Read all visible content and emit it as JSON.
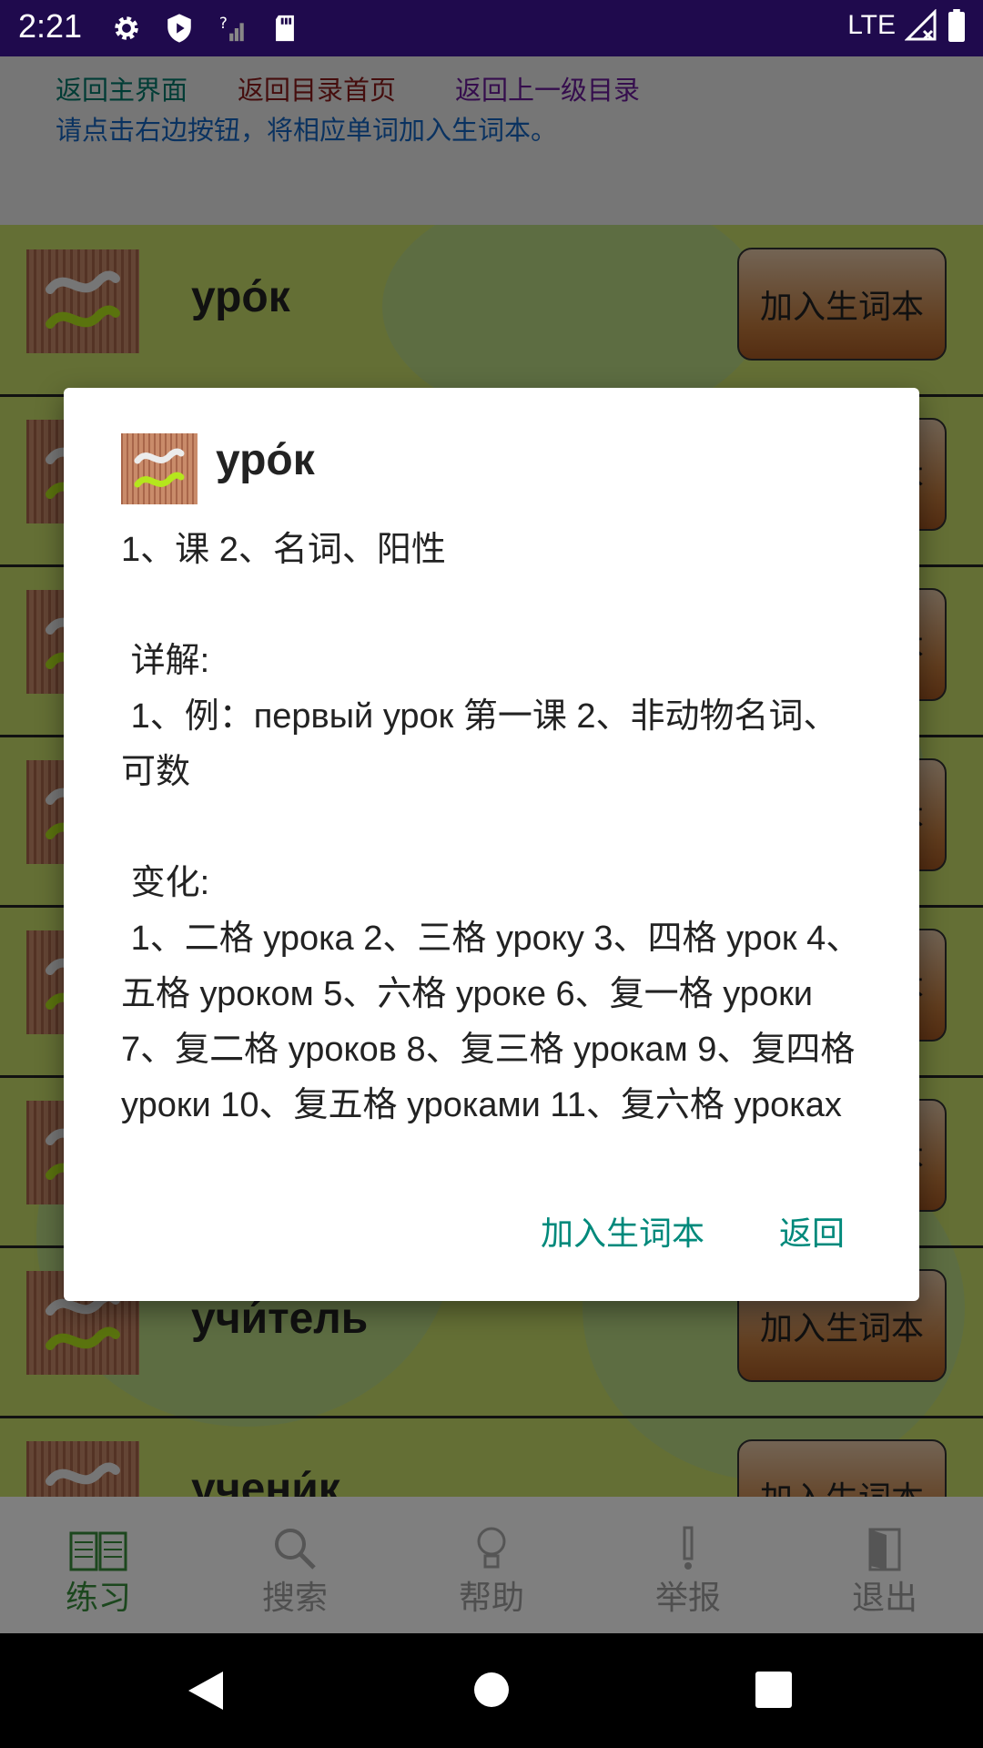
{
  "status_bar": {
    "time": "2:21",
    "network": "LTE",
    "icons": [
      "gear-icon",
      "shield-play-icon",
      "no-signal-icon",
      "sd-card-icon",
      "signal-icon",
      "battery-icon"
    ]
  },
  "top_nav": {
    "links": [
      {
        "label": "返回主界面",
        "color": "#00796b"
      },
      {
        "label": "返回目录首页",
        "color": "#8b1a1a"
      },
      {
        "label": "返回上一级目录",
        "color": "#6a1b9a"
      }
    ],
    "hint": "请点击右边按钮，将相应单词加入生词本。"
  },
  "word_list": {
    "add_label": "加入生词本",
    "rows": [
      {
        "word": "уро́к"
      },
      {
        "word": ""
      },
      {
        "word": ""
      },
      {
        "word": ""
      },
      {
        "word": ""
      },
      {
        "word": ""
      },
      {
        "word": "учи́тель"
      },
      {
        "word": "учени́к"
      }
    ]
  },
  "bottom_nav": {
    "tabs": [
      {
        "label": "练习",
        "icon": "book-icon",
        "active": true
      },
      {
        "label": "搜索",
        "icon": "search-icon",
        "active": false
      },
      {
        "label": "帮助",
        "icon": "lightbulb-icon",
        "active": false
      },
      {
        "label": "举报",
        "icon": "exclamation-icon",
        "active": false
      },
      {
        "label": "退出",
        "icon": "door-icon",
        "active": false
      }
    ]
  },
  "dialog": {
    "title": "уро́к",
    "body": "1、课 2、名词、阳性\n\n 详解:\n 1、例：первый урок 第一课 2、非动物名词、可数\n\n 变化:\n 1、二格 урока 2、三格 уроку 3、四格 урок 4、五格 уроком 5、六格 уроке 6、复一格 уроки 7、复二格 уроков 8、复三格 урокам 9、复四格 уроки 10、复五格 уроками 11、复六格 уроках",
    "add_button": "加入生词本",
    "back_button": "返回",
    "accent": "#00897b"
  },
  "nav_bar": {
    "buttons": [
      "back-icon",
      "home-icon",
      "recents-icon"
    ]
  }
}
